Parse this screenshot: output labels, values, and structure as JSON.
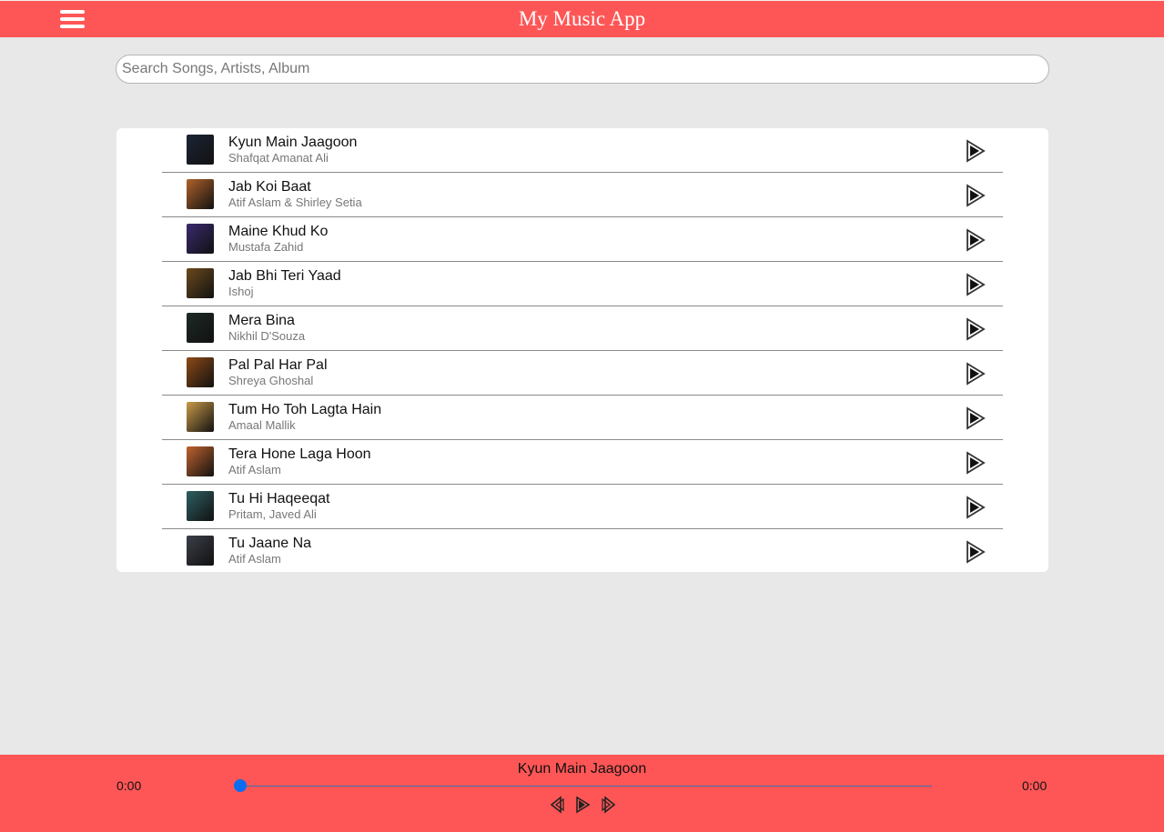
{
  "header": {
    "title": "My Music App",
    "menu_icon": "hamburger-menu-icon"
  },
  "search": {
    "placeholder": "Search Songs, Artists, Album",
    "value": ""
  },
  "songs": [
    {
      "title": "Kyun Main Jaagoon",
      "artist": "Shafqat Amanat Ali",
      "thumb_color": "#1c2535"
    },
    {
      "title": "Jab Koi Baat",
      "artist": "Atif Aslam & Shirley Setia",
      "thumb_color": "#b0622a"
    },
    {
      "title": "Maine Khud Ko",
      "artist": "Mustafa Zahid",
      "thumb_color": "#3a2a6e"
    },
    {
      "title": "Jab Bhi Teri Yaad",
      "artist": "Ishoj",
      "thumb_color": "#6b4a1e"
    },
    {
      "title": "Mera Bina",
      "artist": "Nikhil D'Souza",
      "thumb_color": "#1d2a26"
    },
    {
      "title": "Pal Pal Har Pal",
      "artist": "Shreya Ghoshal",
      "thumb_color": "#8e4a16"
    },
    {
      "title": "Tum Ho Toh Lagta Hain",
      "artist": "Amaal Mallik",
      "thumb_color": "#c99a4a"
    },
    {
      "title": "Tera Hone Laga Hoon",
      "artist": "Atif Aslam",
      "thumb_color": "#c0632e"
    },
    {
      "title": "Tu Hi Haqeeqat",
      "artist": "Pritam, Javed Ali",
      "thumb_color": "#2e5f62"
    },
    {
      "title": "Tu Jaane Na",
      "artist": "Atif Aslam",
      "thumb_color": "#3c3f48"
    }
  ],
  "player": {
    "now_playing": "Kyun Main Jaagoon",
    "current_time": "0:00",
    "duration": "0:00",
    "progress": 0,
    "icons": [
      "previous-icon",
      "play-icon",
      "next-icon"
    ]
  },
  "colors": {
    "accent": "#fe5656",
    "background": "#e8e8e8",
    "progress_knob": "#0a6cf0"
  }
}
